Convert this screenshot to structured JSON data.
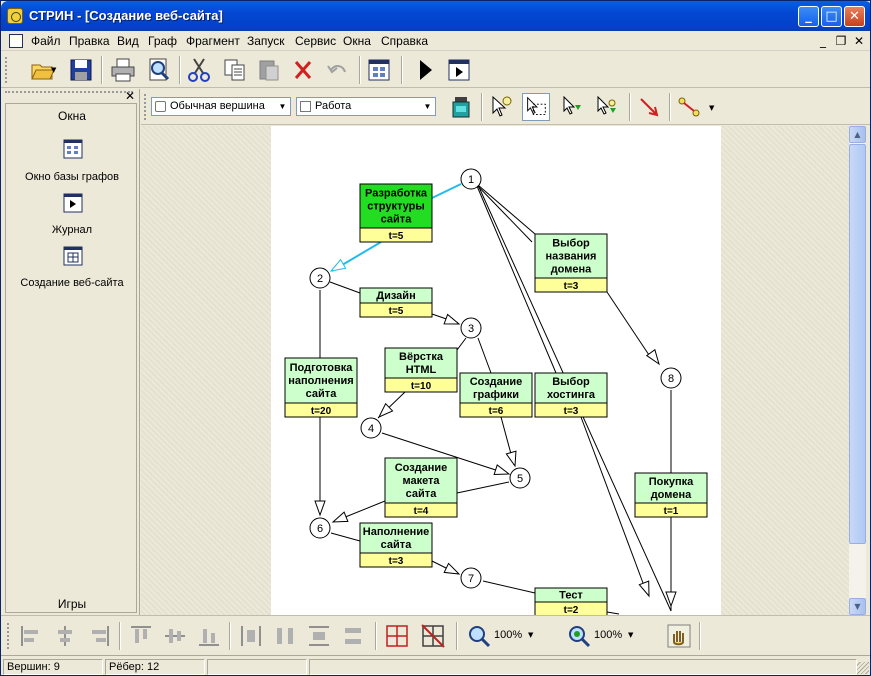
{
  "window": {
    "title": "СТРИН - [Создание веб-сайта]"
  },
  "menu": {
    "items": [
      "Файл",
      "Правка",
      "Вид",
      "Граф",
      "Фрагмент",
      "Запуск",
      "Сервис",
      "Окна",
      "Справка"
    ]
  },
  "left_panel": {
    "header": "Окна",
    "items": [
      {
        "label": "Окно базы графов",
        "icon": "graph-base-window-icon"
      },
      {
        "label": "Журнал",
        "icon": "journal-icon"
      },
      {
        "label": "Создание веб-сайта",
        "icon": "graph-document-icon"
      }
    ],
    "footer": "Игры"
  },
  "toolbar2": {
    "vertex_type": "Обычная вершина",
    "edge_type": "Работа"
  },
  "zoom": {
    "zoom1": "100%",
    "zoom2": "100%"
  },
  "status": {
    "vertices": "Вершин: 9",
    "edges": "Рёбер: 12"
  },
  "graph": {
    "nodes": [
      {
        "id": "1"
      },
      {
        "id": "2"
      },
      {
        "id": "3"
      },
      {
        "id": "4"
      },
      {
        "id": "5"
      },
      {
        "id": "6"
      },
      {
        "id": "7"
      },
      {
        "id": "8"
      }
    ],
    "tasks": [
      {
        "name": "Разработка структуры сайта",
        "lines": [
          "Разработка",
          "структуры",
          "сайта"
        ],
        "time": "t=5",
        "selected": true
      },
      {
        "name": "Выбор названия домена",
        "lines": [
          "Выбор",
          "названия",
          "домена"
        ],
        "time": "t=3"
      },
      {
        "name": "Дизайн",
        "lines": [
          "Дизайн"
        ],
        "time": "t=5"
      },
      {
        "name": "Вёрстка HTML",
        "lines": [
          "Вёрстка",
          "HTML"
        ],
        "time": "t=10"
      },
      {
        "name": "Подготовка наполнения сайта",
        "lines": [
          "Подготовка",
          "наполнения",
          "сайта"
        ],
        "time": "t=20"
      },
      {
        "name": "Создание графики",
        "lines": [
          "Создание",
          "графики"
        ],
        "time": "t=6"
      },
      {
        "name": "Выбор хостинга",
        "lines": [
          "Выбор",
          "хостинга"
        ],
        "time": "t=3"
      },
      {
        "name": "Создание макета сайта",
        "lines": [
          "Создание",
          "макета",
          "сайта"
        ],
        "time": "t=4"
      },
      {
        "name": "Покупка домена",
        "lines": [
          "Покупка",
          "домена"
        ],
        "time": "t=1"
      },
      {
        "name": "Наполнение сайта",
        "lines": [
          "Наполнение",
          "сайта"
        ],
        "time": "t=3"
      },
      {
        "name": "Тест",
        "lines": [
          "Тест"
        ],
        "time": "t=2"
      }
    ]
  },
  "colors": {
    "selected_task": "#22dd22",
    "task_bg": "#ccffcc",
    "time_bg": "#ffff99",
    "selected_edge": "#22bbee"
  }
}
